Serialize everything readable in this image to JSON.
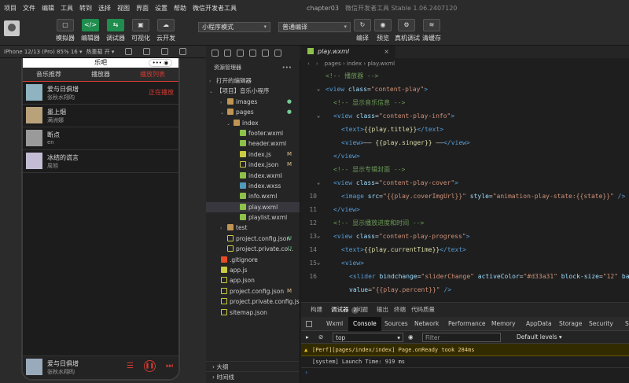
{
  "menubar": {
    "items": [
      "项目",
      "文件",
      "编辑",
      "工具",
      "转到",
      "选择",
      "视图",
      "界面",
      "设置",
      "帮助",
      "微信开发者工具"
    ],
    "project_name": "chapter03",
    "app_name": "微信开发者工具 Stable 1.06.2407120"
  },
  "toolbar": {
    "left_buttons": [
      {
        "label": "模拟器",
        "glyph": "▢"
      },
      {
        "label": "编辑器",
        "glyph": "</>"
      },
      {
        "label": "调试器",
        "glyph": "⇆"
      },
      {
        "label": "可视化",
        "glyph": "▣"
      },
      {
        "label": "云开发",
        "glyph": "☁"
      }
    ],
    "mode_select": "小程序模式",
    "compile_select": "普通编译",
    "right_buttons": [
      {
        "label": "编译",
        "glyph": "↻"
      },
      {
        "label": "预览",
        "glyph": "◉"
      },
      {
        "label": "真机调试",
        "glyph": "⚙"
      },
      {
        "label": "清缓存",
        "glyph": "≋"
      }
    ]
  },
  "simulator": {
    "device": "iPhone 12/13 (Pro) 85% 16 ▾",
    "hot_reload": "热重载 开 ▾",
    "page_title": "乐吧",
    "capsule": "•••  ◉",
    "tabs": [
      "音乐推荐",
      "播放器",
      "播放列表"
    ],
    "active_tab": 2,
    "songs": [
      {
        "title": "爱与日俱增",
        "singer": "张秋水翔昀",
        "status": "正在播放"
      },
      {
        "title": "墨上烟",
        "singer": "满洲娜",
        "status": ""
      },
      {
        "title": "断点",
        "singer": "en",
        "status": ""
      },
      {
        "title": "冰结的谎言",
        "singer": "周旭",
        "status": ""
      }
    ],
    "footer": {
      "title": "爱与日俱增",
      "singer": "张秋水翔昀"
    }
  },
  "explorer": {
    "header": "资源管理器",
    "more": "•••",
    "sections": {
      "open_editors": "打开的编辑器",
      "project": "【项目】音乐小程序",
      "outline": "大纲",
      "timeline": "时间线"
    },
    "tree": [
      {
        "name": "images",
        "type": "folder",
        "depth": 1,
        "badge": "●",
        "badge_color": "#73c991",
        "twisty": "›"
      },
      {
        "name": "pages",
        "type": "folder",
        "depth": 1,
        "badge": "●",
        "badge_color": "#73c991",
        "twisty": "⌄"
      },
      {
        "name": "index",
        "type": "folder",
        "depth": 2,
        "badge": "",
        "badge_color": "",
        "twisty": "⌄"
      },
      {
        "name": "footer.wxml",
        "type": "wxml",
        "depth": 3,
        "badge": "",
        "badge_color": ""
      },
      {
        "name": "header.wxml",
        "type": "wxml",
        "depth": 3,
        "badge": "",
        "badge_color": ""
      },
      {
        "name": "index.js",
        "type": "js",
        "depth": 3,
        "badge": "M",
        "badge_color": "#e2c08d"
      },
      {
        "name": "index.json",
        "type": "json",
        "depth": 3,
        "badge": "M",
        "badge_color": "#e2c08d"
      },
      {
        "name": "index.wxml",
        "type": "wxml",
        "depth": 3,
        "badge": "",
        "badge_color": ""
      },
      {
        "name": "index.wxss",
        "type": "wxss",
        "depth": 3,
        "badge": "",
        "badge_color": ""
      },
      {
        "name": "info.wxml",
        "type": "wxml",
        "depth": 3,
        "badge": "",
        "badge_color": ""
      },
      {
        "name": "play.wxml",
        "type": "wxml",
        "depth": 3,
        "badge": "",
        "badge_color": "",
        "selected": true
      },
      {
        "name": "playlist.wxml",
        "type": "wxml",
        "depth": 3,
        "badge": "",
        "badge_color": ""
      },
      {
        "name": "test",
        "type": "folder",
        "depth": 1,
        "badge": "",
        "badge_color": "",
        "twisty": "›"
      },
      {
        "name": "project.config.json",
        "type": "json",
        "depth": 1,
        "badge": "U",
        "badge_color": "#73c991"
      },
      {
        "name": "project.private.co...",
        "type": "json",
        "depth": 1,
        "badge": "U",
        "badge_color": "#73c991"
      },
      {
        "name": ".gitignore",
        "type": "git",
        "depth": 0,
        "badge": "",
        "badge_color": ""
      },
      {
        "name": "app.js",
        "type": "js",
        "depth": 0,
        "badge": "",
        "badge_color": ""
      },
      {
        "name": "app.json",
        "type": "json",
        "depth": 0,
        "badge": "",
        "badge_color": ""
      },
      {
        "name": "project.config.json",
        "type": "json",
        "depth": 0,
        "badge": "M",
        "badge_color": "#e2c08d"
      },
      {
        "name": "project.private.config.json",
        "type": "json",
        "depth": 0,
        "badge": "",
        "badge_color": ""
      },
      {
        "name": "sitemap.json",
        "type": "json",
        "depth": 0,
        "badge": "",
        "badge_color": ""
      }
    ]
  },
  "editor": {
    "tab": "play.wxml",
    "breadcrumb": "pages › index › play.wxml",
    "lines": [
      {
        "n": "",
        "fold": false,
        "indent": 0,
        "parts": [
          [
            "c-com",
            "<!-- 播放器 -->"
          ]
        ]
      },
      {
        "n": "",
        "fold": true,
        "indent": 0,
        "parts": [
          [
            "c-tag",
            "<view "
          ],
          [
            "c-attr",
            "class"
          ],
          [
            "c-txt",
            "="
          ],
          [
            "c-str",
            "\"content-play\""
          ],
          [
            "c-tag",
            ">"
          ]
        ]
      },
      {
        "n": "",
        "fold": false,
        "indent": 1,
        "parts": [
          [
            "c-com",
            "<!-- 显示音乐信息 -->"
          ]
        ]
      },
      {
        "n": "",
        "fold": true,
        "indent": 1,
        "parts": [
          [
            "c-tag",
            "<view "
          ],
          [
            "c-attr",
            "class"
          ],
          [
            "c-txt",
            "="
          ],
          [
            "c-str",
            "\"content-play-info\""
          ],
          [
            "c-tag",
            ">"
          ]
        ]
      },
      {
        "n": "",
        "fold": false,
        "indent": 2,
        "parts": [
          [
            "c-tag",
            "<text>"
          ],
          [
            "c-mus",
            "{{play.title}}"
          ],
          [
            "c-tag",
            "</text>"
          ]
        ]
      },
      {
        "n": "",
        "fold": false,
        "indent": 2,
        "parts": [
          [
            "c-tag",
            "<view>"
          ],
          [
            "c-txt",
            "—— "
          ],
          [
            "c-mus",
            "{{play.singer}}"
          ],
          [
            "c-txt",
            " ——"
          ],
          [
            "c-tag",
            "</view>"
          ]
        ]
      },
      {
        "n": "",
        "fold": false,
        "indent": 1,
        "parts": [
          [
            "c-tag",
            "</view>"
          ]
        ]
      },
      {
        "n": "",
        "fold": false,
        "indent": 1,
        "parts": [
          [
            "c-com",
            "<!-- 显示专辑封面 -->"
          ]
        ]
      },
      {
        "n": "",
        "fold": true,
        "indent": 1,
        "parts": [
          [
            "c-tag",
            "<view "
          ],
          [
            "c-attr",
            "class"
          ],
          [
            "c-txt",
            "="
          ],
          [
            "c-str",
            "\"content-play-cover\""
          ],
          [
            "c-tag",
            ">"
          ]
        ]
      },
      {
        "n": "10",
        "fold": false,
        "indent": 2,
        "parts": [
          [
            "c-tag",
            "<image "
          ],
          [
            "c-attr",
            "src"
          ],
          [
            "c-txt",
            "="
          ],
          [
            "c-str",
            "\"{{play.coverImgUrl}}\""
          ],
          [
            "c-txt",
            " "
          ],
          [
            "c-attr",
            "style"
          ],
          [
            "c-txt",
            "="
          ],
          [
            "c-str",
            "\"animation-play-state:{{state}}\""
          ],
          [
            "c-tag",
            " />"
          ]
        ]
      },
      {
        "n": "11",
        "fold": false,
        "indent": 1,
        "parts": [
          [
            "c-tag",
            "</view>"
          ]
        ]
      },
      {
        "n": "12",
        "fold": false,
        "indent": 1,
        "parts": [
          [
            "c-com",
            "<!-- 显示播放进度和时间 -->"
          ]
        ]
      },
      {
        "n": "13",
        "fold": true,
        "indent": 1,
        "parts": [
          [
            "c-tag",
            "<view "
          ],
          [
            "c-attr",
            "class"
          ],
          [
            "c-txt",
            "="
          ],
          [
            "c-str",
            "\"content-play-progress\""
          ],
          [
            "c-tag",
            ">"
          ]
        ]
      },
      {
        "n": "14",
        "fold": false,
        "indent": 2,
        "parts": [
          [
            "c-tag",
            "<text>"
          ],
          [
            "c-mus",
            "{{play.currentTime}}"
          ],
          [
            "c-tag",
            "</text>"
          ]
        ]
      },
      {
        "n": "15",
        "fold": true,
        "indent": 2,
        "parts": [
          [
            "c-tag",
            "<view>"
          ]
        ]
      },
      {
        "n": "16",
        "fold": false,
        "indent": 3,
        "parts": [
          [
            "c-tag",
            "<slider "
          ],
          [
            "c-attr",
            "bindchange"
          ],
          [
            "c-txt",
            "="
          ],
          [
            "c-str",
            "\"sliderChange\""
          ],
          [
            "c-txt",
            " "
          ],
          [
            "c-attr",
            "activeColor"
          ],
          [
            "c-txt",
            "="
          ],
          [
            "c-str",
            "\"#d33a31\""
          ],
          [
            "c-txt",
            " "
          ],
          [
            "c-attr",
            "block-size"
          ],
          [
            "c-txt",
            "="
          ],
          [
            "c-str",
            "\"12\""
          ],
          [
            "c-txt",
            " "
          ],
          [
            "c-attr",
            "ba"
          ]
        ]
      },
      {
        "n": "",
        "fold": false,
        "indent": 3,
        "parts": [
          [
            "c-attr",
            "value"
          ],
          [
            "c-txt",
            "="
          ],
          [
            "c-str",
            "\"{{play.percent}}\""
          ],
          [
            "c-tag",
            " />"
          ]
        ]
      }
    ]
  },
  "devtools": {
    "top_tabs": [
      "构建",
      "调试器",
      "问题",
      "输出",
      "终端",
      "代码质量"
    ],
    "debugger_count": "2",
    "panel_tabs": [
      "Wxml",
      "Console",
      "Sources",
      "Network",
      "Performance",
      "Memory",
      "AppData",
      "Storage",
      "Security",
      "S"
    ],
    "active_panel": 1,
    "context": "top",
    "filter_placeholder": "Filter",
    "levels": "Default levels ▾",
    "logs": {
      "warn": "[Perf][pages/index/index] Page.onReady took 284ms",
      "info": "[system] Launch Time: 919 ms",
      "prompt": "›"
    }
  }
}
